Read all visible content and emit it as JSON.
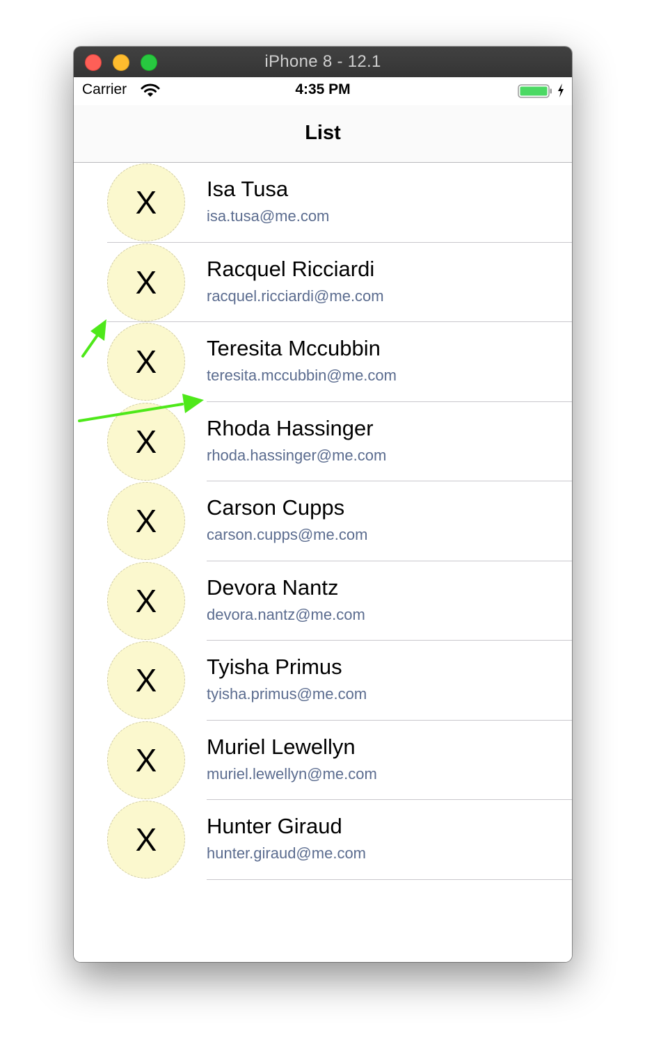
{
  "window": {
    "title": "iPhone 8 - 12.1"
  },
  "status_bar": {
    "carrier": "Carrier",
    "time": "4:35 PM",
    "wifi_icon": "wifi-icon",
    "battery_icon": "battery-full-charging-icon",
    "battery_color": "#4cd964"
  },
  "nav": {
    "title": "List"
  },
  "avatar_color": "#fbf8ce",
  "email_color": "#5b6c8f",
  "annotation_color": "#4ee81a",
  "contacts": [
    {
      "avatar": "X",
      "name": "Isa Tusa",
      "email": "isa.tusa@me.com"
    },
    {
      "avatar": "X",
      "name": "Racquel Ricciardi",
      "email": "racquel.ricciardi@me.com"
    },
    {
      "avatar": "X",
      "name": "Teresita Mccubbin",
      "email": "teresita.mccubbin@me.com"
    },
    {
      "avatar": "X",
      "name": "Rhoda Hassinger",
      "email": "rhoda.hassinger@me.com"
    },
    {
      "avatar": "X",
      "name": "Carson Cupps",
      "email": "carson.cupps@me.com"
    },
    {
      "avatar": "X",
      "name": "Devora Nantz",
      "email": "devora.nantz@me.com"
    },
    {
      "avatar": "X",
      "name": "Tyisha Primus",
      "email": "tyisha.primus@me.com"
    },
    {
      "avatar": "X",
      "name": "Muriel Lewellyn",
      "email": "muriel.lewellyn@me.com"
    },
    {
      "avatar": "X",
      "name": "Hunter Giraud",
      "email": "hunter.giraud@me.com"
    }
  ]
}
